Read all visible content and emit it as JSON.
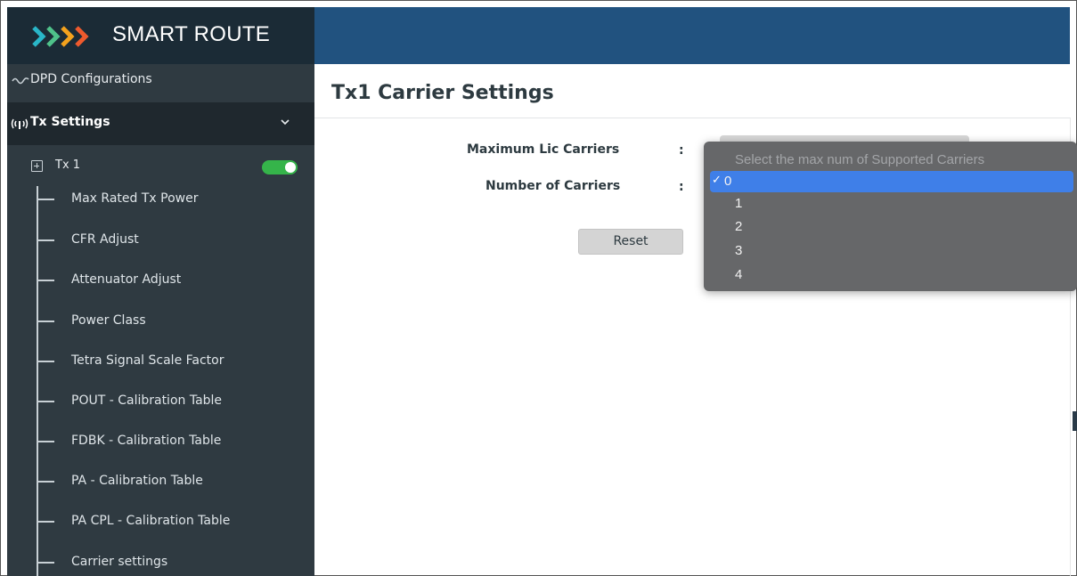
{
  "brand": {
    "name": "SMART ROUTE",
    "chevron_colors": [
      "#29b6c8",
      "#4fc28a",
      "#f4a21d",
      "#ef5a2d"
    ]
  },
  "sidebar": {
    "dpd_label": "DPD Configurations",
    "tx_settings_label": "Tx Settings",
    "tx1": {
      "label": "Tx 1",
      "enabled": true
    },
    "items": [
      {
        "label": "Max Rated Tx Power"
      },
      {
        "label": "CFR Adjust"
      },
      {
        "label": "Attenuator Adjust"
      },
      {
        "label": "Power Class"
      },
      {
        "label": "Tetra Signal Scale Factor"
      },
      {
        "label": "POUT - Calibration Table"
      },
      {
        "label": "FDBK - Calibration Table"
      },
      {
        "label": "PA - Calibration Table"
      },
      {
        "label": "PA CPL - Calibration Table"
      },
      {
        "label": "Carrier settings"
      }
    ]
  },
  "main": {
    "title": "Tx1 Carrier Settings",
    "fields": [
      {
        "label": "Maximum Lic Carriers",
        "colon": ":"
      },
      {
        "label": "Number of Carriers",
        "colon": ":"
      }
    ],
    "reset_label": "Reset"
  },
  "dropdown": {
    "placeholder": "Select the max num of Supported Carriers",
    "selected_mark": "✓",
    "options": [
      "0",
      "1",
      "2",
      "3",
      "4"
    ],
    "selected_index": 0
  },
  "colors": {
    "sidebar_bg": "#2f3a41",
    "topbar_bg": "#21527f",
    "toggle_on": "#35b44a",
    "selected_option": "#3f7fe8"
  }
}
